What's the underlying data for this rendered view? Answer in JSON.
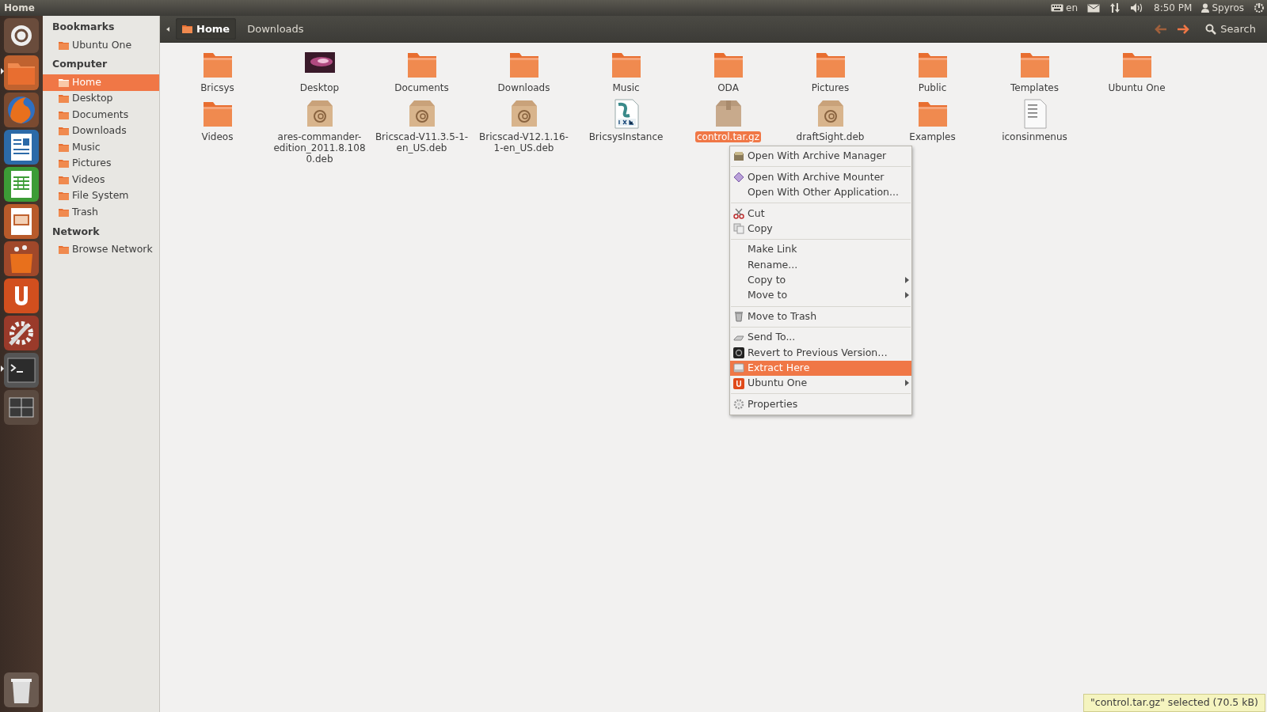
{
  "top_panel": {
    "title": "Home",
    "keyboard": "en",
    "time": "8:50 PM",
    "user": "Spyros"
  },
  "launcher": [
    {
      "kind": "dash",
      "running": false
    },
    {
      "kind": "files",
      "running": true
    },
    {
      "kind": "browser",
      "running": false
    },
    {
      "kind": "writer",
      "running": false
    },
    {
      "kind": "calc",
      "running": false
    },
    {
      "kind": "impress",
      "running": false
    },
    {
      "kind": "software",
      "running": false
    },
    {
      "kind": "ubuntuone",
      "running": false
    },
    {
      "kind": "settings",
      "running": false
    },
    {
      "kind": "terminal",
      "running": true
    },
    {
      "kind": "workspaces",
      "running": false
    }
  ],
  "launcher_bottom": [
    {
      "kind": "trash",
      "running": false
    }
  ],
  "toolbar": {
    "breadcrumbs": [
      {
        "label": "Home",
        "selected": true
      },
      {
        "label": "Downloads",
        "selected": false
      }
    ],
    "search": "Search"
  },
  "sidebar": [
    {
      "heading": "Bookmarks",
      "items": [
        {
          "label": "Ubuntu One",
          "selected": false
        }
      ]
    },
    {
      "heading": "Computer",
      "items": [
        {
          "label": "Home",
          "selected": true
        },
        {
          "label": "Desktop",
          "selected": false
        },
        {
          "label": "Documents",
          "selected": false
        },
        {
          "label": "Downloads",
          "selected": false
        },
        {
          "label": "Music",
          "selected": false
        },
        {
          "label": "Pictures",
          "selected": false
        },
        {
          "label": "Videos",
          "selected": false
        },
        {
          "label": "File System",
          "selected": false
        },
        {
          "label": "Trash",
          "selected": false
        }
      ]
    },
    {
      "heading": "Network",
      "items": [
        {
          "label": "Browse Network",
          "selected": false
        }
      ]
    }
  ],
  "files": [
    {
      "label": "Bricsys",
      "kind": "folder",
      "selected": false
    },
    {
      "label": "Desktop",
      "kind": "desktop",
      "selected": false
    },
    {
      "label": "Documents",
      "kind": "folder",
      "selected": false
    },
    {
      "label": "Downloads",
      "kind": "folder",
      "selected": false
    },
    {
      "label": "Music",
      "kind": "folder",
      "selected": false
    },
    {
      "label": "ODA",
      "kind": "folder",
      "selected": false
    },
    {
      "label": "Pictures",
      "kind": "folder",
      "selected": false
    },
    {
      "label": "Public",
      "kind": "folder",
      "selected": false
    },
    {
      "label": "Templates",
      "kind": "folder",
      "selected": false
    },
    {
      "label": "Ubuntu One",
      "kind": "folder",
      "selected": false
    },
    {
      "label": "Videos",
      "kind": "folder",
      "selected": false
    },
    {
      "label": "ares-commander-edition_2011.8.1080.deb",
      "kind": "package",
      "selected": false
    },
    {
      "label": "Bricscad-V11.3.5-1-en_US.deb",
      "kind": "package",
      "selected": false
    },
    {
      "label": "Bricscad-V12.1.16-1-en_US.deb",
      "kind": "package",
      "selected": false
    },
    {
      "label": "BricsysInstance",
      "kind": "dxf",
      "selected": false
    },
    {
      "label": "control.tar.gz",
      "kind": "archive",
      "selected": true
    },
    {
      "label": "draftSight.deb",
      "kind": "package",
      "selected": false
    },
    {
      "label": "Examples",
      "kind": "folder",
      "selected": false
    },
    {
      "label": "iconsinmenus",
      "kind": "text",
      "selected": false
    }
  ],
  "context_menu": [
    [
      {
        "label": "Open With Archive Manager",
        "kind": "archive",
        "submenu": false,
        "selected": false
      }
    ],
    [
      {
        "label": "Open With Archive Mounter",
        "kind": "mounter",
        "submenu": false,
        "selected": false
      },
      {
        "label": "Open With Other Application...",
        "kind": "none",
        "submenu": false,
        "selected": false
      }
    ],
    [
      {
        "label": "Cut",
        "kind": "cut",
        "submenu": false,
        "selected": false
      },
      {
        "label": "Copy",
        "kind": "copy",
        "submenu": false,
        "selected": false
      }
    ],
    [
      {
        "label": "Make Link",
        "kind": "none",
        "submenu": false,
        "selected": false
      },
      {
        "label": "Rename...",
        "kind": "none",
        "submenu": false,
        "selected": false
      },
      {
        "label": "Copy to",
        "kind": "none",
        "submenu": true,
        "selected": false
      },
      {
        "label": "Move to",
        "kind": "none",
        "submenu": true,
        "selected": false
      }
    ],
    [
      {
        "label": "Move to Trash",
        "kind": "trash",
        "submenu": false,
        "selected": false
      }
    ],
    [
      {
        "label": "Send To...",
        "kind": "send",
        "submenu": false,
        "selected": false
      },
      {
        "label": "Revert to Previous Version…",
        "kind": "revert",
        "submenu": false,
        "selected": false
      },
      {
        "label": "Extract Here",
        "kind": "extract",
        "submenu": false,
        "selected": true
      },
      {
        "label": "Ubuntu One",
        "kind": "ubuntuone",
        "submenu": true,
        "selected": false
      }
    ],
    [
      {
        "label": "Properties",
        "kind": "properties",
        "submenu": false,
        "selected": false
      }
    ]
  ],
  "status_bar": "\"control.tar.gz\" selected (70.5 kB)"
}
